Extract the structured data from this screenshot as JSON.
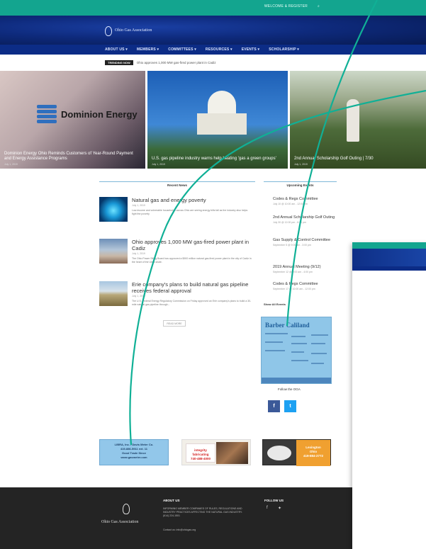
{
  "topbar": {
    "welcome": "WELCOME & REGISTER",
    "search_icon": "search-icon"
  },
  "header": {
    "org_name": "Ohio Gas Association"
  },
  "nav": {
    "items": [
      "ABOUT US ▾",
      "MEMBERS ▾",
      "COMMITTEES ▾",
      "RESOURCES ▾",
      "EVENTS ▾",
      "SCHOLARSHIP ▾"
    ]
  },
  "trending": {
    "tag": "TRENDING NOW",
    "text": "Ohio approves 1,000 MW gas-fired power plant in Cadiz"
  },
  "hero": [
    {
      "caption": "Dominion Energy Ohio Reminds Customers of Year-Round Payment and Energy Assistance Programs",
      "date": "July 1, 2019",
      "logo": "Dominion Energy"
    },
    {
      "caption": "U.S. gas pipeline industry warns help heating 'gas a green groups'",
      "date": "July 1, 2019"
    },
    {
      "caption": "2nd Annual Scholarship Golf Outing | 7/30",
      "date": "July 1, 2019"
    }
  ],
  "recent_news": {
    "heading": "Recent News",
    "items": [
      {
        "title": "Natural gas and energy poverty",
        "meta": "July 1, 2019",
        "body": "Low-income and vulnerable households across Ohio are seeing energy bills fall as the industry also helps fight the poverty"
      },
      {
        "title": "Ohio approves 1,000 MW gas-fired power plant in Cadiz",
        "meta": "July 1, 2019",
        "body": "The Ohio Power Siting Board has approved a $900 million natural gas-fired power plant in the city of Cadiz in the heart of the Utica shale."
      },
      {
        "title": "Erie company's plans to build natural gas pipeline receives federal approval",
        "meta": "July 1, 2019",
        "body": "The U.S. Federal Energy Regulatory Commission on Friday approved an Erie company's plans to build a 30-mile natural gas pipeline through..."
      }
    ],
    "read_more": "READ MORE"
  },
  "upcoming_events": {
    "heading": "Upcoming Events",
    "items": [
      {
        "title": "Codes & Regs Committee",
        "date": "July 10 @ 10:00 am - 12:00 pm"
      },
      {
        "title": "2nd Annual Scholarship Golf Outing",
        "date": "July 30 @ 12:00 pm - 6:00 pm"
      },
      {
        "title": "Gas Supply & Control Committee",
        "date": "September 5 @ 9:00 am - 3:00 pm"
      },
      {
        "title": "2019 Annual Meeting (9/12)",
        "date": "September 12 @ 9:00 am - 4:00 pm"
      },
      {
        "title": "Codes & Regs Committee",
        "date": "September 17 @ 10:00 am - 12:00 pm"
      }
    ],
    "show_all": "Show All Events"
  },
  "ad_box": {
    "headline": "Barber Caliland"
  },
  "follow": {
    "heading": "Follow the OGA",
    "facebook": "f",
    "twitter": "t"
  },
  "ads": {
    "blue": [
      "LIBRA, Inc. / Davis Meter Co.",
      "419-886-5911 ext. 11",
      "Good Trade Since",
      "www.gasmeter.com"
    ],
    "integrity": [
      "integrity",
      "fabricating",
      "740-488-4000"
    ],
    "lexington": [
      "Lexington",
      "Ohio",
      "419-884-2772"
    ]
  },
  "footer": {
    "org_name": "Ohio Gas Association",
    "about_heading": "ABOUT US",
    "about_text": "INFORMING MEMBER COMPANIES OF RULES, REGULATIONS AND INDUSTRY PRACTICES AFFECTING THE NATURAL GAS INDUSTRY.",
    "phone": "(614) 224-1501",
    "contact": "Contact us: info@ohiogas.org",
    "follow_heading": "FOLLOW US"
  },
  "colors": {
    "teal": "#13a58f",
    "navy": "#0c2c86",
    "footer": "#242424",
    "ad_blue": "#8fc6e8"
  }
}
